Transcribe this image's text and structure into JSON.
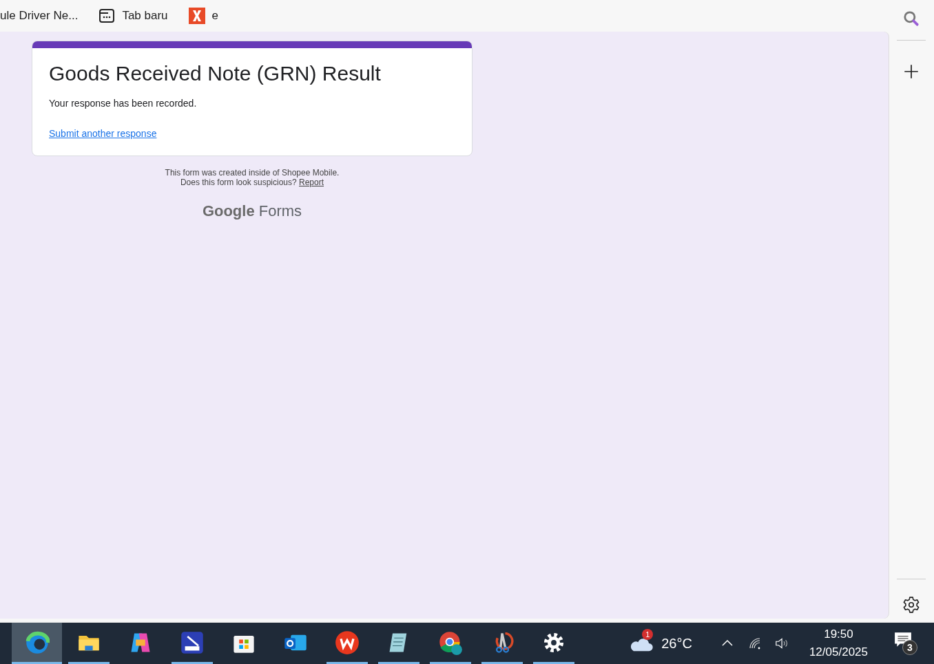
{
  "browser_tabs": [
    {
      "title": "ule Driver Ne...",
      "kind": "none"
    },
    {
      "title": "Tab baru",
      "kind": "newtab"
    },
    {
      "title": "e",
      "kind": "x"
    }
  ],
  "form": {
    "title": "Goods Received Note (GRN) Result",
    "message": "Your response has been recorded.",
    "link": "Submit another response",
    "footer_line_1": "This form was created inside of Shopee Mobile.",
    "footer_line_2": "Does this form look suspicious?",
    "report_link": "Report",
    "brand_1": "Google",
    "brand_2": "Forms"
  },
  "taskbar": {
    "apps": [
      {
        "kind": "edge",
        "selected": true,
        "running": true
      },
      {
        "kind": "folder",
        "selected": false,
        "running": true
      },
      {
        "kind": "copilot",
        "selected": false,
        "running": false
      },
      {
        "kind": "scanner",
        "selected": false,
        "running": true
      },
      {
        "kind": "store",
        "selected": false,
        "running": false
      },
      {
        "kind": "outlook",
        "selected": false,
        "running": false
      },
      {
        "kind": "wps",
        "selected": false,
        "running": true
      },
      {
        "kind": "notepad",
        "selected": false,
        "running": true
      },
      {
        "kind": "chrome",
        "selected": false,
        "running": true
      },
      {
        "kind": "snip",
        "selected": false,
        "running": true
      },
      {
        "kind": "gear",
        "selected": false,
        "running": true
      }
    ],
    "weather_badge": "1",
    "temperature": "26°C",
    "time": "19:50",
    "date": "12/05/2025",
    "notifications": "3"
  }
}
